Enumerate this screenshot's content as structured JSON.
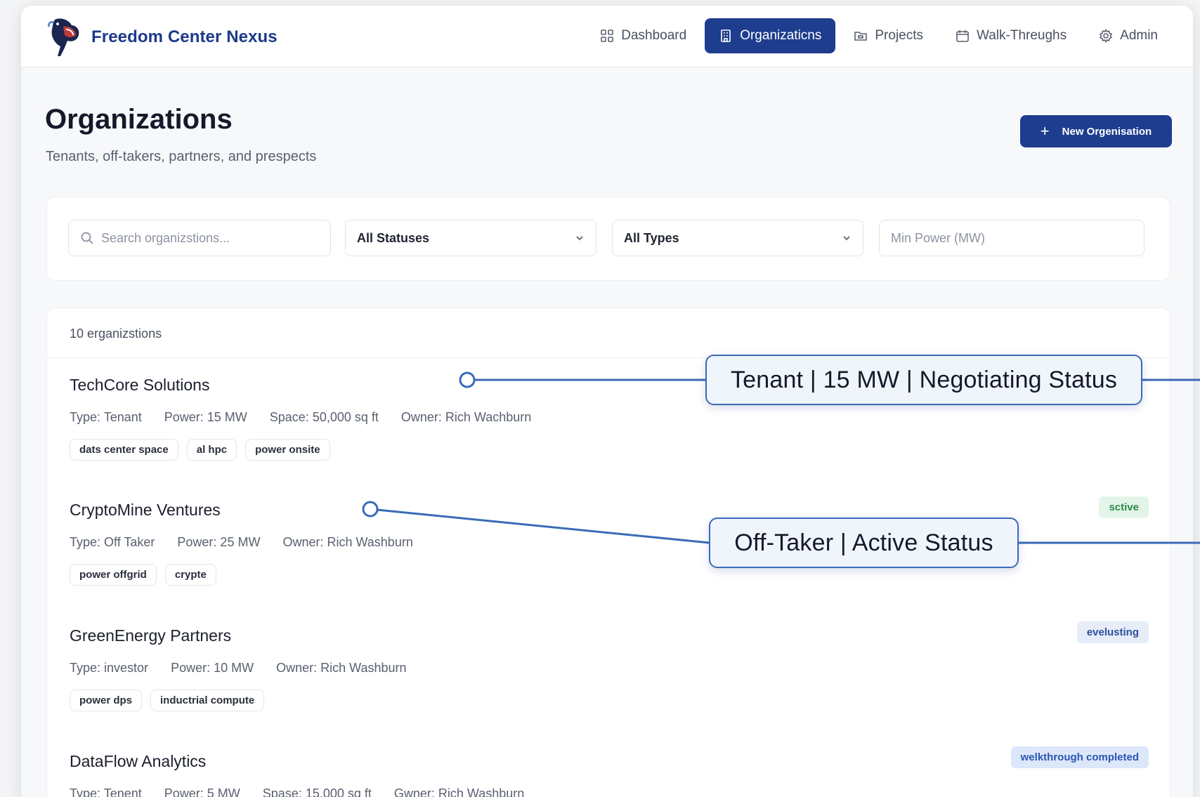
{
  "app": {
    "name": "Freedom Center Nexus"
  },
  "nav": {
    "items": [
      {
        "label": "Dashboard",
        "icon": "grid-icon",
        "active": false
      },
      {
        "label": "Organizaticns",
        "icon": "building-icon",
        "active": true
      },
      {
        "label": "Projects",
        "icon": "folder-icon",
        "active": false
      },
      {
        "label": "Walk-Threughs",
        "icon": "calendar-icon",
        "active": false
      },
      {
        "label": "Admin",
        "icon": "gear-icon",
        "active": false
      }
    ]
  },
  "page": {
    "title": "Organizations",
    "subtitle": "Tenants, off-takers, partners, and prespects",
    "new_button_label": "New Orgenisation"
  },
  "filters": {
    "search_placeholder": "Search organizstions...",
    "status_value": "All Statuses",
    "type_value": "All Types",
    "power_placeholder": "Min Power (MW)"
  },
  "list": {
    "count_label": "10 erganizstions",
    "orgs": [
      {
        "name": "TechCore Solutions",
        "meta": [
          "Type: Tenant",
          "Power: 15 MW",
          "Space: 50,000 sq ft",
          "Owner: Rich Wachburn"
        ],
        "tags": [
          "dats center space",
          "al hpc",
          "power onsite"
        ],
        "badge": ""
      },
      {
        "name": "CryptoMine Ventures",
        "meta": [
          "Type: Off Taker",
          "Power: 25 MW",
          "Owner: Rich Washburn"
        ],
        "tags": [
          "power offgrid",
          "crypte"
        ],
        "badge": "sctive"
      },
      {
        "name": "GreenEnergy Partners",
        "meta": [
          "Type: investor",
          "Power: 10 MW",
          "Owner: Rich Washburn"
        ],
        "tags": [
          "power dps",
          "inductrial compute"
        ],
        "badge": "evelusting"
      },
      {
        "name": "DataFlow Analytics",
        "meta": [
          "Type: Tenent",
          "Power: 5 MW",
          "Spase: 15,000 sq ft",
          "Gwner: Rich Washburn"
        ],
        "tags": [],
        "badge": "welkthrough completed"
      }
    ]
  },
  "annotations": {
    "callout_1": "Tenant | 15 MW | Negotiating Status",
    "callout_2": "Off-Taker | Active Status"
  },
  "colors": {
    "primary": "#1f3d8e",
    "callout_border": "#3a6bb8",
    "badge_green_bg": "#e3f5e8",
    "badge_blue_bg": "#e6edf9"
  }
}
